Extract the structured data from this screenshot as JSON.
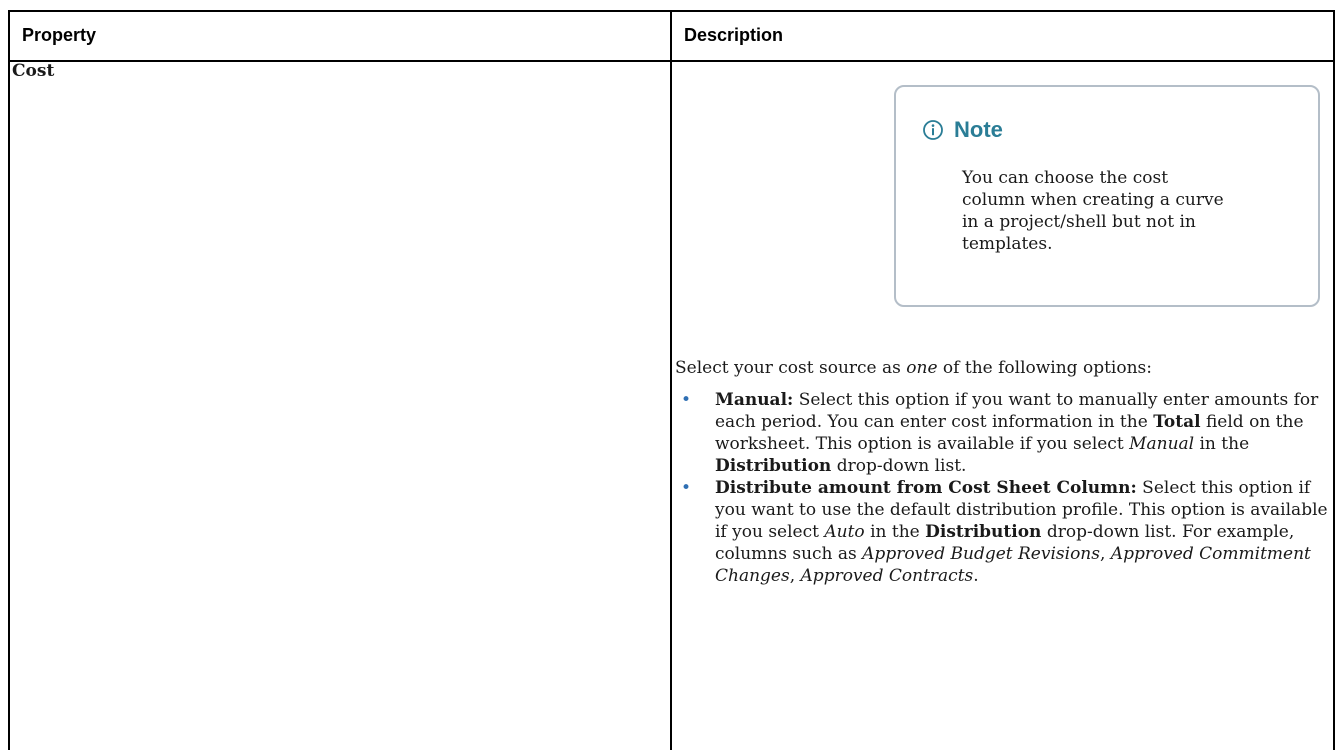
{
  "table": {
    "headers": {
      "property": "Property",
      "description": "Description"
    },
    "row": {
      "property": "Cost",
      "note": {
        "title": "Note",
        "icon": "info-circle-icon",
        "lines": [
          "You can choose the cost",
          "column when creating a curve",
          "in a project/shell but not in",
          "templates."
        ]
      },
      "intro": {
        "before": "Select your cost source as ",
        "emphasis": "one",
        "after": " of the following options:"
      },
      "options": [
        {
          "name": "Manual:",
          "text1": " Select this option if you want to manually enter amounts for each period. You can enter cost information in the ",
          "bold1": "Total",
          "text2": " field on the worksheet. This option is available if you select ",
          "italic1": "Manual",
          "text3": " in the ",
          "bold2": "Distribution",
          "text4": " drop-down list."
        },
        {
          "name": "Distribute amount from Cost Sheet Column:",
          "text1": " Select this option if you want to use the default distribution profile. This option is available if you select ",
          "italic1": "Auto",
          "text2": " in the ",
          "bold1": "Distribution",
          "text3": " drop-down list. For example, columns such as ",
          "italic2": "Approved Budget Revisions",
          "text4": ", ",
          "italic3": "Approved Commitment Changes",
          "text5": ", ",
          "italic4": "Approved Contracts",
          "text6": "."
        }
      ]
    }
  },
  "colors": {
    "note_title": "#2a7d96",
    "note_border": "#b4bec8",
    "bullet": "#2f6fb3"
  }
}
